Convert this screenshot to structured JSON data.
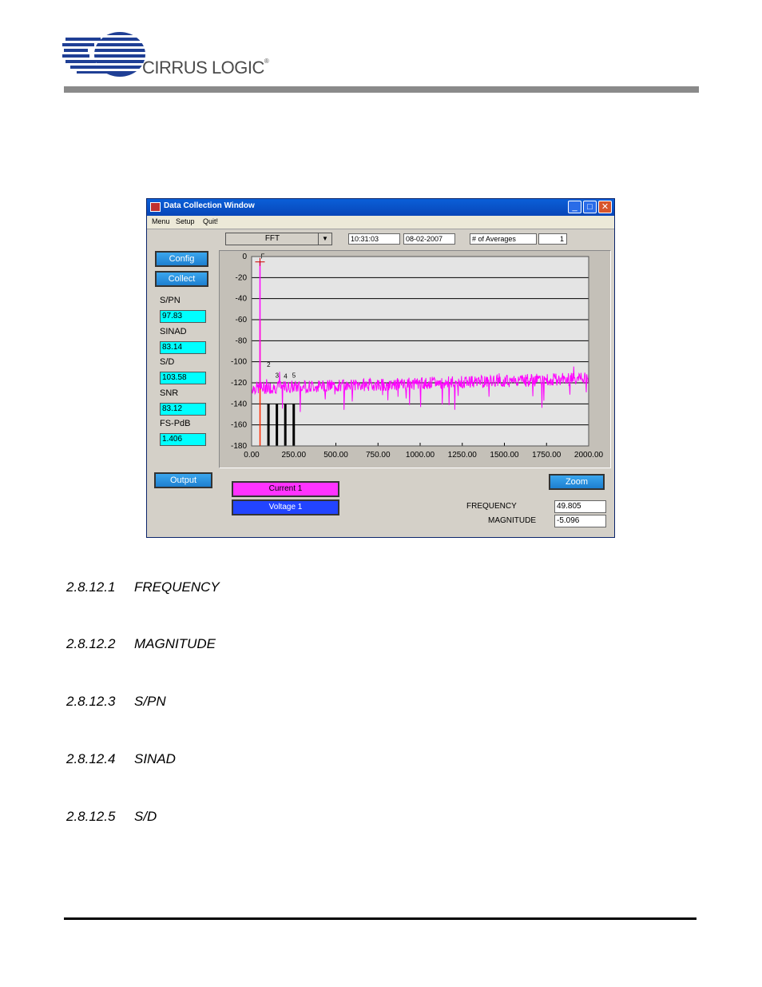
{
  "header": {
    "logo_text": "CIRRUS LOGIC",
    "logo_mark": "®"
  },
  "window": {
    "title": "Data Collection Window",
    "controls": {
      "minimize": "_",
      "maximize": "□",
      "close": "✕"
    },
    "menu": [
      "Menu",
      "Setup",
      "Quit!"
    ],
    "buttons": {
      "config": "Config",
      "collect": "Collect",
      "output": "Output",
      "zoom": "Zoom"
    },
    "mode_select": "FFT",
    "time": "10:31:03",
    "date": "08-02-2007",
    "averages_label": "# of Averages",
    "averages_value": "1",
    "metrics": [
      {
        "label": "S/PN",
        "value": "97.83"
      },
      {
        "label": "SINAD",
        "value": "83.14"
      },
      {
        "label": "S/D",
        "value": "103.58"
      },
      {
        "label": "SNR",
        "value": "83.12"
      },
      {
        "label": "FS-PdB",
        "value": "1.406"
      }
    ],
    "channels": [
      {
        "label": "Current 1",
        "color": "#ff33ff"
      },
      {
        "label": "Voltage 1",
        "color": "#2244ff"
      }
    ],
    "readout": {
      "frequency_label": "FREQUENCY",
      "frequency_value": "49.805",
      "magnitude_label": "MAGNITUDE",
      "magnitude_value": "-5.096"
    }
  },
  "chart_data": {
    "type": "line",
    "title": "",
    "xlabel": "",
    "ylabel": "",
    "xlim": [
      0,
      2000
    ],
    "ylim": [
      -180,
      0
    ],
    "x_ticks": [
      "0.00",
      "250.00",
      "500.00",
      "750.00",
      "1000.00",
      "1250.00",
      "1500.00",
      "1750.00",
      "2000.00"
    ],
    "y_ticks": [
      "0",
      "-20",
      "-40",
      "-60",
      "-80",
      "-100",
      "-120",
      "-140",
      "-160",
      "-180"
    ],
    "grid": "horizontal",
    "series": [
      {
        "color": "#ff00ff",
        "fundamental": {
          "x": 49.805,
          "y": -5.096
        },
        "noise_floor_start": -125,
        "noise_floor_end": -116
      }
    ],
    "harmonics": [
      {
        "label": "F",
        "x": 50,
        "y": -5
      },
      {
        "label": "2",
        "x": 100,
        "y": -108
      },
      {
        "label": "3",
        "x": 150,
        "y": -118
      },
      {
        "label": "4",
        "x": 200,
        "y": -119
      },
      {
        "label": "5",
        "x": 250,
        "y": -118
      }
    ],
    "harmonic_bar_bottom": -180
  },
  "sections": [
    {
      "number": "2.8.12.1",
      "title": "FREQUENCY"
    },
    {
      "number": "2.8.12.2",
      "title": "MAGNITUDE"
    },
    {
      "number": "2.8.12.3",
      "title": "S/PN"
    },
    {
      "number": "2.8.12.4",
      "title": "SINAD"
    },
    {
      "number": "2.8.12.5",
      "title": "S/D"
    }
  ]
}
